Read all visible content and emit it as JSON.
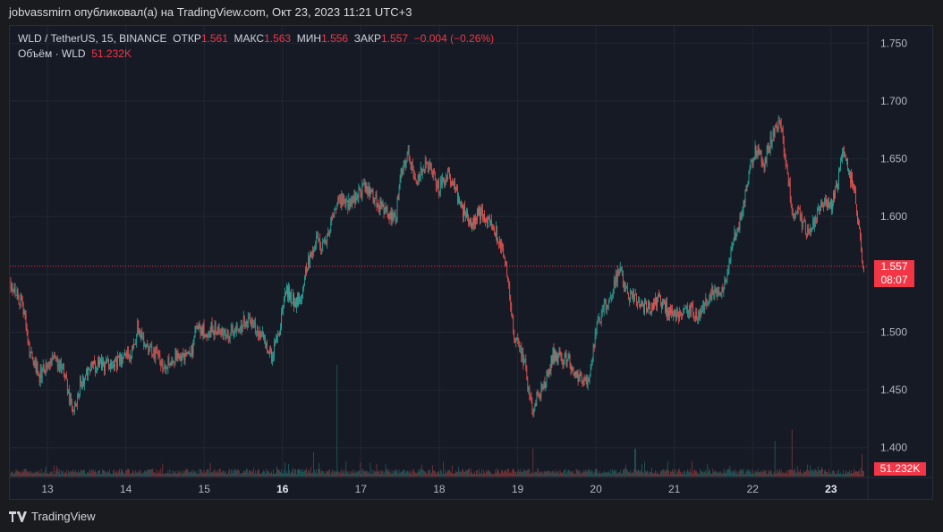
{
  "header": {
    "user": "jobvassmirn",
    "published_text": "опубликовал(а) на TradingView.com, Окт 23, 2023 11:21 UTC+3"
  },
  "legend": {
    "symbol": "WLD / TetherUS, 15, BINANCE",
    "open_label": "ОТКР",
    "open": "1.561",
    "high_label": "МАКС",
    "high": "1.563",
    "low_label": "МИН",
    "low": "1.556",
    "close_label": "ЗАКР",
    "close": "1.557",
    "change": "−0.004 (−0.26%)",
    "volume_label": "Объём · WLD",
    "volume": "51.232K"
  },
  "price_tag": {
    "price": "1.557",
    "countdown": "08:07"
  },
  "volume_tag": "51.232K",
  "footer": {
    "brand": "TradingView"
  },
  "colors": {
    "up": "#26a69a",
    "down": "#ef5350",
    "background": "#161a25",
    "grid": "#232632"
  },
  "chart_data": {
    "type": "candlestick",
    "symbol": "WLD/USDT",
    "timeframe": "15",
    "y_ticks": [
      1.75,
      1.7,
      1.65,
      1.6,
      1.55,
      1.5,
      1.45,
      1.4
    ],
    "y_tick_labels": [
      "1.750",
      "1.700",
      "1.650",
      "1.600",
      "",
      "1.500",
      "1.450",
      "1.400"
    ],
    "ylim": [
      1.375,
      1.765
    ],
    "x_ticks": [
      {
        "label": "13",
        "day": 13,
        "bold": false
      },
      {
        "label": "14",
        "day": 14,
        "bold": false
      },
      {
        "label": "15",
        "day": 15,
        "bold": false
      },
      {
        "label": "16",
        "day": 16,
        "bold": true
      },
      {
        "label": "17",
        "day": 17,
        "bold": false
      },
      {
        "label": "18",
        "day": 18,
        "bold": false
      },
      {
        "label": "19",
        "day": 19,
        "bold": false
      },
      {
        "label": "20",
        "day": 20,
        "bold": false
      },
      {
        "label": "21",
        "day": 21,
        "bold": false
      },
      {
        "label": "22",
        "day": 22,
        "bold": false
      },
      {
        "label": "23",
        "day": 23,
        "bold": true
      }
    ],
    "xlim_days": [
      12.52,
      23.47
    ],
    "last_price": 1.557,
    "close_path": [
      [
        12.52,
        1.545
      ],
      [
        12.6,
        1.535
      ],
      [
        12.7,
        1.52
      ],
      [
        12.75,
        1.49
      ],
      [
        12.82,
        1.475
      ],
      [
        12.9,
        1.462
      ],
      [
        13.0,
        1.47
      ],
      [
        13.1,
        1.478
      ],
      [
        13.2,
        1.468
      ],
      [
        13.3,
        1.437
      ],
      [
        13.35,
        1.43
      ],
      [
        13.42,
        1.455
      ],
      [
        13.5,
        1.465
      ],
      [
        13.6,
        1.47
      ],
      [
        13.75,
        1.472
      ],
      [
        13.9,
        1.475
      ],
      [
        14.0,
        1.478
      ],
      [
        14.1,
        1.485
      ],
      [
        14.15,
        1.505
      ],
      [
        14.25,
        1.49
      ],
      [
        14.4,
        1.48
      ],
      [
        14.5,
        1.472
      ],
      [
        14.6,
        1.478
      ],
      [
        14.75,
        1.48
      ],
      [
        14.85,
        1.485
      ],
      [
        14.9,
        1.505
      ],
      [
        15.0,
        1.5
      ],
      [
        15.1,
        1.503
      ],
      [
        15.2,
        1.5
      ],
      [
        15.3,
        1.498
      ],
      [
        15.45,
        1.505
      ],
      [
        15.55,
        1.51
      ],
      [
        15.65,
        1.502
      ],
      [
        15.75,
        1.498
      ],
      [
        15.85,
        1.478
      ],
      [
        15.95,
        1.497
      ],
      [
        16.0,
        1.522
      ],
      [
        16.05,
        1.535
      ],
      [
        16.1,
        1.532
      ],
      [
        16.15,
        1.525
      ],
      [
        16.25,
        1.535
      ],
      [
        16.32,
        1.56
      ],
      [
        16.4,
        1.575
      ],
      [
        16.45,
        1.58
      ],
      [
        16.5,
        1.57
      ],
      [
        16.6,
        1.588
      ],
      [
        16.68,
        1.61
      ],
      [
        16.75,
        1.615
      ],
      [
        16.85,
        1.612
      ],
      [
        16.95,
        1.618
      ],
      [
        17.05,
        1.625
      ],
      [
        17.15,
        1.62
      ],
      [
        17.25,
        1.608
      ],
      [
        17.35,
        1.602
      ],
      [
        17.45,
        1.6
      ],
      [
        17.5,
        1.638
      ],
      [
        17.6,
        1.652
      ],
      [
        17.7,
        1.63
      ],
      [
        17.8,
        1.645
      ],
      [
        17.9,
        1.64
      ],
      [
        18.0,
        1.625
      ],
      [
        18.1,
        1.638
      ],
      [
        18.2,
        1.625
      ],
      [
        18.3,
        1.605
      ],
      [
        18.4,
        1.595
      ],
      [
        18.5,
        1.602
      ],
      [
        18.6,
        1.6
      ],
      [
        18.7,
        1.59
      ],
      [
        18.8,
        1.575
      ],
      [
        18.85,
        1.555
      ],
      [
        18.9,
        1.53
      ],
      [
        18.95,
        1.5
      ],
      [
        19.0,
        1.49
      ],
      [
        19.1,
        1.47
      ],
      [
        19.15,
        1.445
      ],
      [
        19.2,
        1.432
      ],
      [
        19.25,
        1.445
      ],
      [
        19.35,
        1.455
      ],
      [
        19.45,
        1.48
      ],
      [
        19.55,
        1.478
      ],
      [
        19.65,
        1.475
      ],
      [
        19.75,
        1.465
      ],
      [
        19.8,
        1.458
      ],
      [
        19.9,
        1.455
      ],
      [
        19.95,
        1.475
      ],
      [
        20.0,
        1.505
      ],
      [
        20.1,
        1.52
      ],
      [
        20.2,
        1.535
      ],
      [
        20.3,
        1.555
      ],
      [
        20.4,
        1.532
      ],
      [
        20.5,
        1.528
      ],
      [
        20.6,
        1.522
      ],
      [
        20.7,
        1.52
      ],
      [
        20.8,
        1.53
      ],
      [
        20.9,
        1.52
      ],
      [
        21.0,
        1.515
      ],
      [
        21.1,
        1.518
      ],
      [
        21.2,
        1.52
      ],
      [
        21.3,
        1.515
      ],
      [
        21.4,
        1.527
      ],
      [
        21.5,
        1.535
      ],
      [
        21.6,
        1.535
      ],
      [
        21.7,
        1.56
      ],
      [
        21.75,
        1.58
      ],
      [
        21.85,
        1.6
      ],
      [
        21.95,
        1.64
      ],
      [
        22.05,
        1.66
      ],
      [
        22.15,
        1.645
      ],
      [
        22.25,
        1.67
      ],
      [
        22.35,
        1.682
      ],
      [
        22.45,
        1.635
      ],
      [
        22.5,
        1.605
      ],
      [
        22.6,
        1.6
      ],
      [
        22.7,
        1.585
      ],
      [
        22.8,
        1.6
      ],
      [
        22.9,
        1.61
      ],
      [
        23.0,
        1.61
      ],
      [
        23.1,
        1.635
      ],
      [
        23.15,
        1.66
      ],
      [
        23.22,
        1.64
      ],
      [
        23.3,
        1.625
      ],
      [
        23.37,
        1.58
      ],
      [
        23.42,
        1.557
      ]
    ],
    "volume_spikes": [
      {
        "day": 16.7,
        "relative": 1.0
      },
      {
        "day": 22.5,
        "relative": 0.42
      },
      {
        "day": 22.28,
        "relative": 0.32
      },
      {
        "day": 16.4,
        "relative": 0.22
      },
      {
        "day": 19.2,
        "relative": 0.25
      },
      {
        "day": 20.5,
        "relative": 0.25
      },
      {
        "day": 23.4,
        "relative": 0.2
      }
    ]
  }
}
